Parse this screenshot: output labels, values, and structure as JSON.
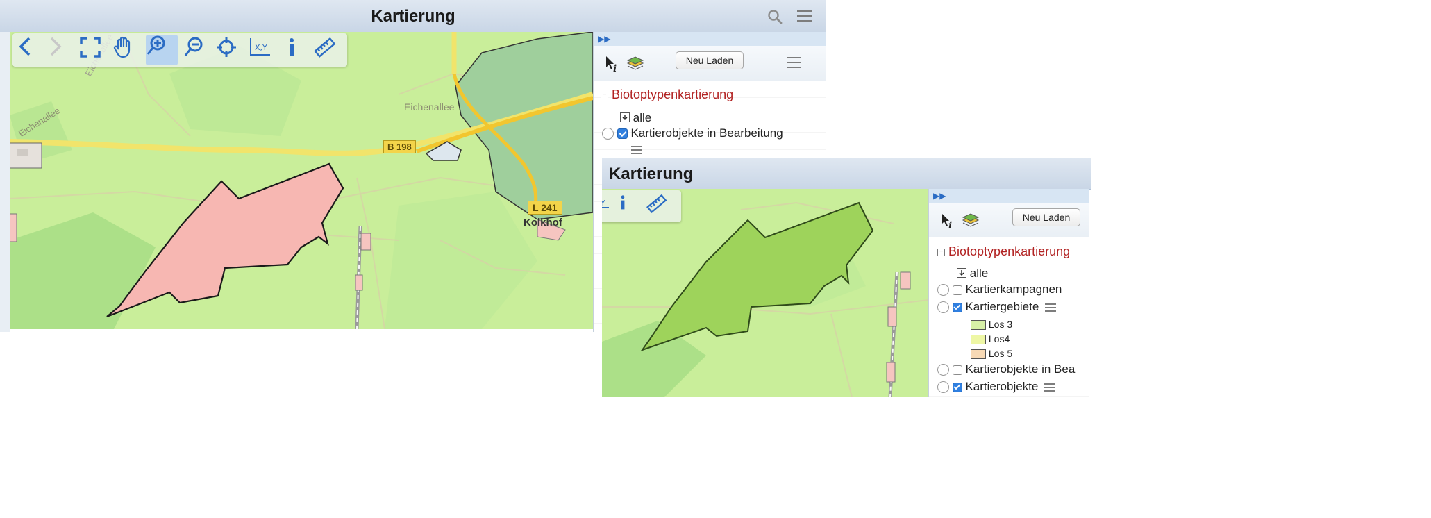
{
  "left_window": {
    "title": "Kartierung",
    "panel": {
      "reload_label": "Neu Laden",
      "group_title": "Biotoptypenkartierung",
      "all_label": "alle",
      "layers": [
        {
          "label": "Kartierobjekte in Bearbeitung",
          "checked": true
        }
      ]
    },
    "map_labels": {
      "street_1": "Eichenallee",
      "street_2": "Eichenallee",
      "street_3": "Eichenallee",
      "road_b": "B 198",
      "road_l": "L 241",
      "place": "Kolkhof"
    },
    "polygon_fill": "#f7b7b2"
  },
  "right_window": {
    "title": "Kartierung",
    "panel": {
      "reload_label": "Neu Laden",
      "group_title": "Biotoptypenkartierung",
      "all_label": "alle",
      "layers": [
        {
          "label": "Kartierkampagnen",
          "checked": false
        },
        {
          "label": "Kartiergebiete",
          "checked": true
        },
        {
          "label": "Kartierobjekte in Bea",
          "checked": false
        },
        {
          "label": "Kartierobjekte",
          "checked": true
        }
      ],
      "legend": [
        {
          "label": "Los 3",
          "color": "#d7f0a7"
        },
        {
          "label": "Los4",
          "color": "#eef7a5"
        },
        {
          "label": "Los 5",
          "color": "#f7d9b5"
        }
      ]
    },
    "polygon_fill": "#9ed35b"
  },
  "toolbar_icons": [
    "back-icon",
    "forward-icon",
    "full-extent-icon",
    "pan-hand-icon",
    "zoom-in-icon",
    "zoom-out-icon",
    "locate-icon",
    "coordinates-icon",
    "info-icon",
    "measure-ruler-icon"
  ],
  "colors": {
    "accent": "#2f7fe0",
    "group_title": "#b22222",
    "map_green": "#c9ee9a"
  }
}
